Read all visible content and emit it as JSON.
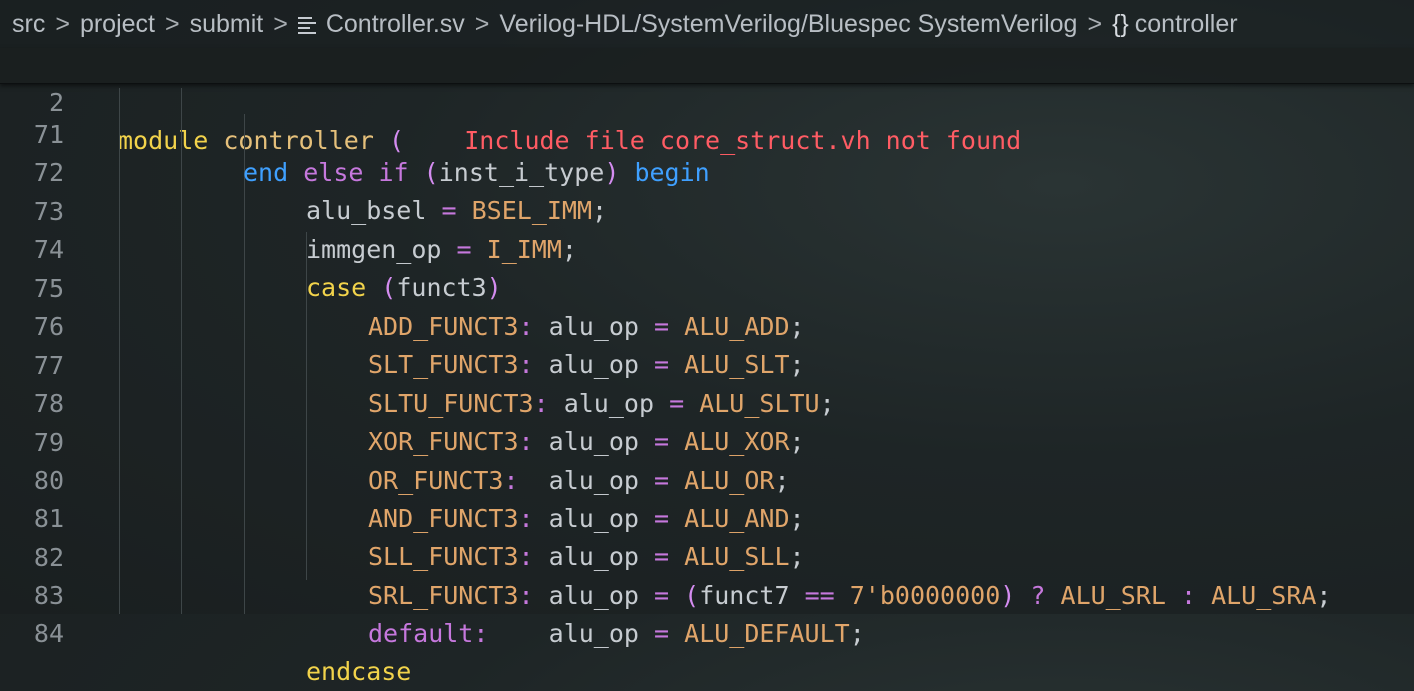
{
  "breadcrumb": {
    "items": [
      "src",
      "project",
      "submit"
    ],
    "file": "Controller.sv",
    "language": "Verilog-HDL/SystemVerilog/Bluespec SystemVerilog",
    "symbol": "controller",
    "separator": ">",
    "symbol_glyph": "{}"
  },
  "sticky": {
    "line_number": "2",
    "keyword": "module",
    "name": "controller",
    "paren": "(",
    "error": "Include file core_struct.vh not found"
  },
  "lines": {
    "l71": {
      "num": "71",
      "t1": "end",
      "t2": "else",
      "t3": "if",
      "t4": "(",
      "t5": "inst_i_type",
      "t6": ")",
      "t7": "begin"
    },
    "l72": {
      "num": "72",
      "lhs": "alu_bsel",
      "op": "=",
      "rhs": "BSEL_IMM",
      "end": ";"
    },
    "l73": {
      "num": "73",
      "lhs": "immgen_op",
      "op": "=",
      "rhs": "I_IMM",
      "end": ";"
    },
    "l74": {
      "num": "74",
      "kw": "case",
      "open": "(",
      "arg": "funct3",
      "close": ")"
    },
    "l75": {
      "num": "75",
      "label": "ADD_FUNCT3",
      "colon": ":",
      "lhs": "alu_op",
      "op": "=",
      "rhs": "ALU_ADD",
      "end": ";"
    },
    "l76": {
      "num": "76",
      "label": "SLT_FUNCT3",
      "colon": ":",
      "lhs": "alu_op",
      "op": "=",
      "rhs": "ALU_SLT",
      "end": ";"
    },
    "l77": {
      "num": "77",
      "label": "SLTU_FUNCT3",
      "colon": ":",
      "lhs": "alu_op",
      "op": "=",
      "rhs": "ALU_SLTU",
      "end": ";"
    },
    "l78": {
      "num": "78",
      "label": "XOR_FUNCT3",
      "colon": ":",
      "lhs": "alu_op",
      "op": "=",
      "rhs": "ALU_XOR",
      "end": ";"
    },
    "l79": {
      "num": "79",
      "label": "OR_FUNCT3",
      "colon": ":",
      "lhs": "alu_op",
      "op": "=",
      "rhs": "ALU_OR",
      "end": ";"
    },
    "l80": {
      "num": "80",
      "label": "AND_FUNCT3",
      "colon": ":",
      "lhs": "alu_op",
      "op": "=",
      "rhs": "ALU_AND",
      "end": ";"
    },
    "l81": {
      "num": "81",
      "label": "SLL_FUNCT3",
      "colon": ":",
      "lhs": "alu_op",
      "op": "=",
      "rhs": "ALU_SLL",
      "end": ";"
    },
    "l82": {
      "num": "82",
      "label": "SRL_FUNCT3",
      "colon": ":",
      "lhs": "alu_op",
      "op": "=",
      "open": "(",
      "a": "funct7",
      "eq": "==",
      "b": "7'b0000000",
      "close": ")",
      "q": "?",
      "t": "ALU_SRL",
      "c": ":",
      "f": "ALU_SRA",
      "end": ";"
    },
    "l83": {
      "num": "83",
      "label": "default",
      "colon": ":",
      "lhs": "alu_op",
      "op": "=",
      "rhs": "ALU_DEFAULT",
      "end": ";"
    },
    "l84": {
      "num": "84",
      "kw": "endcase"
    }
  },
  "colors": {
    "keyword_blue": "#3fa0ff",
    "keyword_purple": "#c678dd",
    "constant_orange": "#e0a56a",
    "error_red": "#ff5c64",
    "module_yellow": "#f2d34b"
  }
}
